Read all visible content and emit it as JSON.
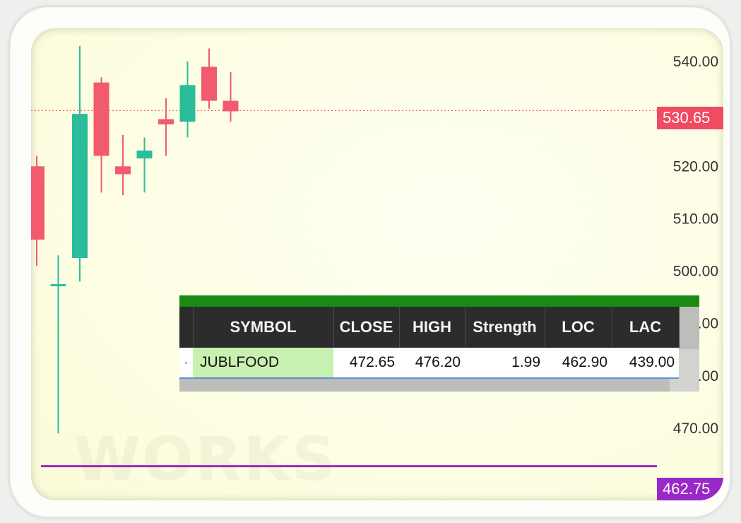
{
  "price_axis": {
    "ticks": [
      "540.00",
      "520.00",
      "510.00",
      "500.00",
      "490.00",
      "480.00",
      "470.00"
    ],
    "tick_values": [
      540,
      520,
      510,
      500,
      490,
      480,
      470
    ],
    "ymax": 545,
    "ymin": 460
  },
  "ltp": {
    "label": "530.65",
    "value": 530.65,
    "color": "#ef4b63"
  },
  "bottom_line": {
    "label": "462.75",
    "value": 462.75,
    "color": "#9a28c8"
  },
  "watermark": "WORKS",
  "candles": [
    {
      "open": 520.0,
      "close": 506.0,
      "high": 522.0,
      "low": 501.0
    },
    {
      "open": 497.5,
      "close": 497.5,
      "high": 503.0,
      "low": 469.0
    },
    {
      "open": 502.5,
      "close": 530.0,
      "high": 543.0,
      "low": 498.0
    },
    {
      "open": 536.0,
      "close": 522.0,
      "high": 537.0,
      "low": 515.0
    },
    {
      "open": 520.0,
      "close": 518.5,
      "high": 526.0,
      "low": 514.5
    },
    {
      "open": 521.5,
      "close": 523.0,
      "high": 525.5,
      "low": 515.0
    },
    {
      "open": 529.0,
      "close": 528.0,
      "high": 533.0,
      "low": 522.0
    },
    {
      "open": 528.5,
      "close": 535.5,
      "high": 540.0,
      "low": 525.5
    },
    {
      "open": 539.0,
      "close": 532.5,
      "high": 542.5,
      "low": 531.0
    },
    {
      "open": 532.5,
      "close": 530.5,
      "high": 538.0,
      "low": 528.5
    }
  ],
  "colors": {
    "up": "#2bbd9b",
    "down": "#f25a6e",
    "axis_text": "#333333"
  },
  "scanner": {
    "columns": [
      "SYMBOL",
      "CLOSE",
      "HIGH",
      "Strength",
      "LOC",
      "LAC"
    ],
    "rows": [
      {
        "lead": "·",
        "symbol": "JUBLFOOD",
        "close": "472.65",
        "high": "476.20",
        "strength": "1.99",
        "loc": "462.90",
        "lac": "439.00"
      }
    ]
  }
}
